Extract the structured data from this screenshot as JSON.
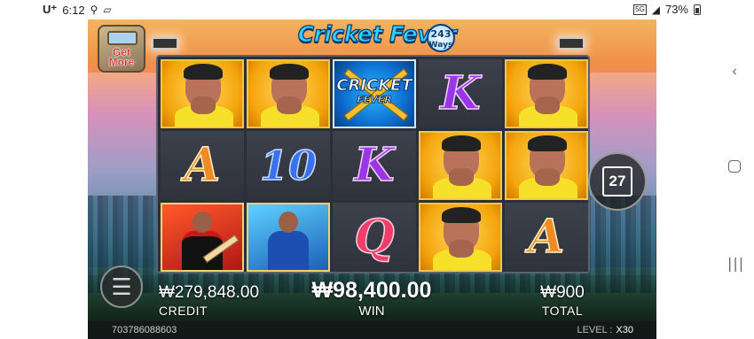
{
  "status_bar": {
    "carrier": "U⁺",
    "time": "6:12",
    "network": "5G",
    "battery": "73%"
  },
  "game": {
    "logo": {
      "title": "Cricket Fever",
      "badge_top": "243",
      "badge_bottom": "Ways"
    },
    "get_more": {
      "line1": "Get",
      "line2": "More"
    },
    "reels": [
      [
        "player",
        "player",
        "wild",
        "K",
        "player"
      ],
      [
        "A",
        "10",
        "K",
        "player",
        "player"
      ],
      [
        "batsman",
        "bowler",
        "Q",
        "player",
        "A"
      ]
    ],
    "wild_symbol": {
      "line1": "CRICKET",
      "line2": "FEVER"
    },
    "counter": "27",
    "credit": {
      "value": "₩279,848.00",
      "label": "CREDIT"
    },
    "win": {
      "value": "₩98,400.00",
      "label": "WIN"
    },
    "total": {
      "value": "₩900",
      "label": "TOTAL"
    },
    "footer": {
      "session_id": "703786088603",
      "level_label": "LEVEL :",
      "level_value": "X30"
    }
  }
}
